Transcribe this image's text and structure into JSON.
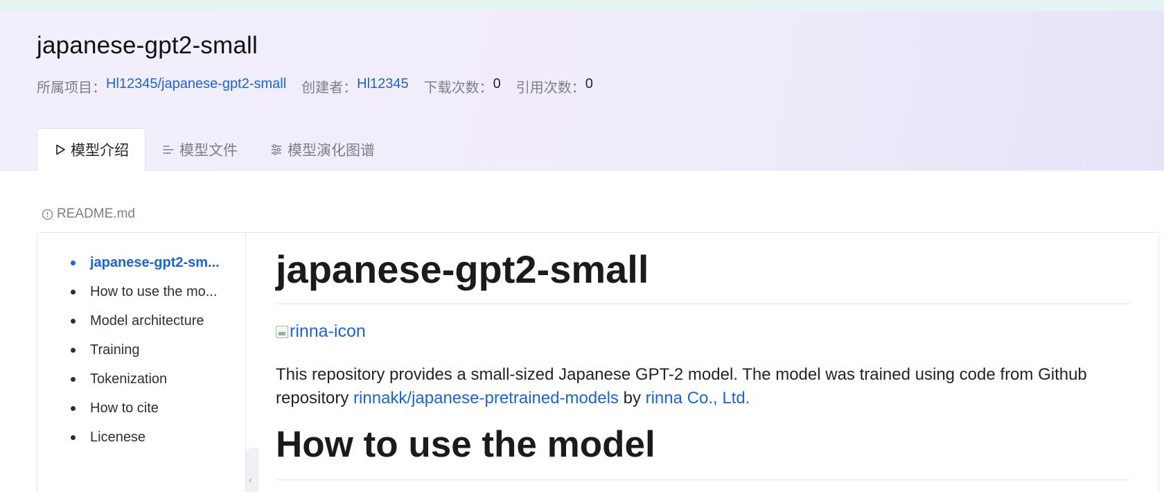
{
  "model": {
    "title": "japanese-gpt2-small",
    "project_label": "所属项目：",
    "project_value": "Hl12345/japanese-gpt2-small",
    "creator_label": "创建者：",
    "creator_value": "Hl12345",
    "downloads_label": "下载次数：",
    "downloads_value": "0",
    "citations_label": "引用次数：",
    "citations_value": "0"
  },
  "tabs": [
    {
      "label": "模型介绍",
      "icon": "play-outline-icon",
      "active": true
    },
    {
      "label": "模型文件",
      "icon": "list-lines-icon",
      "active": false
    },
    {
      "label": "模型演化图谱",
      "icon": "sliders-icon",
      "active": false
    }
  ],
  "readme": {
    "file_label": "README.md",
    "icon": "info-circle-icon"
  },
  "toc": {
    "items": [
      {
        "label": "japanese-gpt2-sm...",
        "active": true
      },
      {
        "label": "How to use the mo...",
        "active": false
      },
      {
        "label": "Model architecture",
        "active": false
      },
      {
        "label": "Training",
        "active": false
      },
      {
        "label": "Tokenization",
        "active": false
      },
      {
        "label": "How to cite",
        "active": false
      },
      {
        "label": "Licenese",
        "active": false
      }
    ],
    "collapse_glyph": "‹"
  },
  "content": {
    "h1": "japanese-gpt2-small",
    "image_alt": "rinna-icon",
    "para_text_1": "This repository provides a small-sized Japanese GPT-2 model. The model was trained using code from Github repository ",
    "para_link_1": "rinnakk/japanese-pretrained-models",
    "para_text_2": " by ",
    "para_link_2": "rinna Co., Ltd.",
    "h2": "How to use the model"
  },
  "colors": {
    "accent": "#1d63d1",
    "hero_bg": "#f3eefb",
    "top_strip": "#e4f4f3"
  }
}
